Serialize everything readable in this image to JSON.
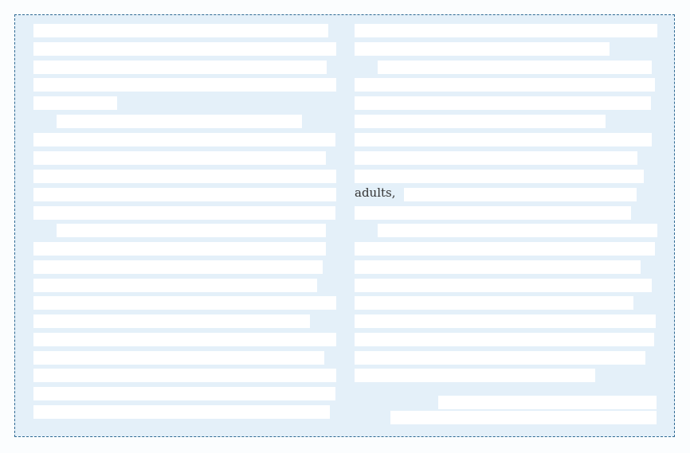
{
  "document": {
    "visible_word": "adults,"
  }
}
